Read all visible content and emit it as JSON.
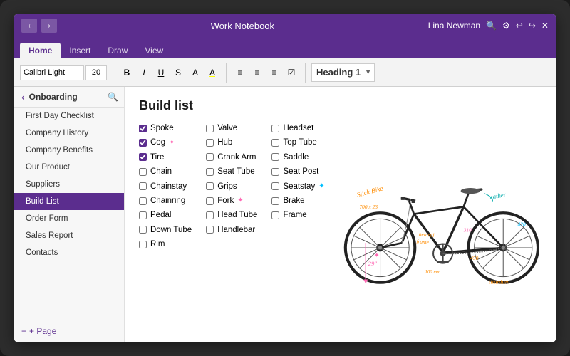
{
  "titleBar": {
    "notebookName": "Work Notebook",
    "userName": "Lina Newman",
    "navBack": "‹",
    "navForward": "›"
  },
  "ribbon": {
    "tabs": [
      "Home",
      "Insert",
      "Draw",
      "View"
    ],
    "activeTab": "Home",
    "fontName": "Calibri Light",
    "fontSize": "20",
    "formatButtons": [
      "B",
      "I",
      "U",
      "S",
      "A",
      "A"
    ],
    "headingLabel": "Heading 1",
    "listButtons": [
      "≡",
      "≡",
      "≡",
      "☑"
    ]
  },
  "sidebar": {
    "notebookLabel": "Onboarding",
    "items": [
      {
        "label": "First Day Checklist",
        "active": false
      },
      {
        "label": "Company History",
        "active": false
      },
      {
        "label": "Company Benefits",
        "active": false
      },
      {
        "label": "Our Product",
        "active": false
      },
      {
        "label": "Suppliers",
        "active": false
      },
      {
        "label": "Build List",
        "active": true
      },
      {
        "label": "Order Form",
        "active": false
      },
      {
        "label": "Sales Report",
        "active": false
      },
      {
        "label": "Contacts",
        "active": false
      }
    ],
    "addPageLabel": "+ Page"
  },
  "pageContent": {
    "title": "Build list",
    "col1": [
      {
        "text": "Spoke",
        "checked": true
      },
      {
        "text": "Cog",
        "checked": true,
        "star": true
      },
      {
        "text": "Tire",
        "checked": true
      },
      {
        "text": "Chain",
        "checked": false
      },
      {
        "text": "Chainstay",
        "checked": false
      },
      {
        "text": "Chainring",
        "checked": false
      },
      {
        "text": "Pedal",
        "checked": false
      },
      {
        "text": "Down Tube",
        "checked": false
      },
      {
        "text": "Rim",
        "checked": false
      }
    ],
    "col2": [
      {
        "text": "Valve",
        "checked": false
      },
      {
        "text": "Hub",
        "checked": false
      },
      {
        "text": "Crank Arm",
        "checked": false
      },
      {
        "text": "Seat Tube",
        "checked": false
      },
      {
        "text": "Grips",
        "checked": false
      },
      {
        "text": "Fork",
        "checked": false,
        "star": true
      },
      {
        "text": "Head Tube",
        "checked": false
      },
      {
        "text": "Handlebar",
        "checked": false
      }
    ],
    "col3": [
      {
        "text": "Headset",
        "checked": false
      },
      {
        "text": "Top Tube",
        "checked": false
      },
      {
        "text": "Saddle",
        "checked": false
      },
      {
        "text": "Seat Post",
        "checked": false
      },
      {
        "text": "Seatstay",
        "checked": false,
        "star": true
      },
      {
        "text": "Brake",
        "checked": false
      },
      {
        "text": "Frame",
        "checked": false
      }
    ],
    "annotations": {
      "slickBike": "Slick Bike",
      "dimensions": "700 x 23",
      "size29": "29\"",
      "leather": "leather",
      "neutralFrame": "neutral frame",
      "titanium": "titanium",
      "m310": "310",
      "m450": "450",
      "m420": "420",
      "m100mm": "100 mm"
    }
  }
}
